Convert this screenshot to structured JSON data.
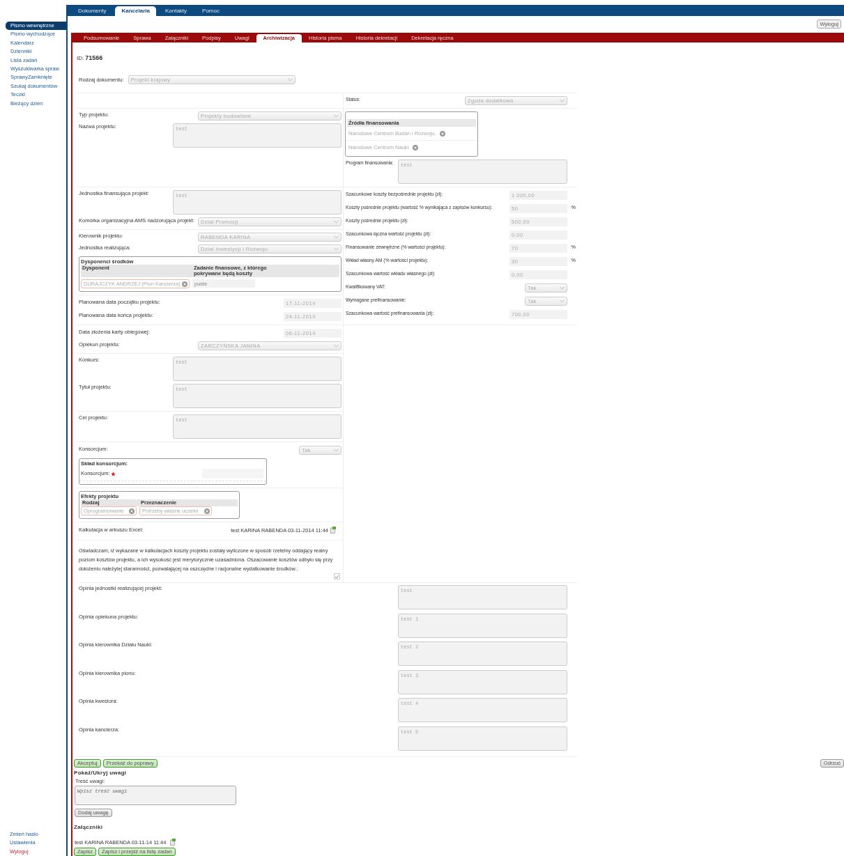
{
  "top_nav": [
    {
      "label": "Dokumenty",
      "selected": false
    },
    {
      "label": "Kancelaria",
      "selected": true
    },
    {
      "label": "Kontakty",
      "selected": false
    },
    {
      "label": "Pomoc",
      "selected": false
    }
  ],
  "logout_button": "Wyloguj",
  "sidebar": {
    "items": [
      {
        "label": "Pismo wewnętrzne",
        "selected": true
      },
      {
        "label": "Pismo wychodzące",
        "selected": false
      },
      {
        "label": "Kalendarz",
        "selected": false
      },
      {
        "label": "Dzienniki",
        "selected": false
      },
      {
        "label": "Lista zadań",
        "selected": false
      },
      {
        "label": "Wyszukiwarka spraw",
        "selected": false
      },
      {
        "label": "SprawyZamknięte",
        "selected": false
      },
      {
        "label": "Szukaj dokumentów",
        "selected": false
      },
      {
        "label": "Teczki",
        "selected": false
      },
      {
        "label": "Bieżący dzień",
        "selected": false
      }
    ],
    "bottom_links": [
      {
        "label": "Zmień hasło",
        "kind": "link"
      },
      {
        "label": "Ustawienia",
        "kind": "link"
      },
      {
        "label": "Wyloguj",
        "kind": "logout"
      }
    ]
  },
  "tabs": [
    {
      "label": "Podsumowanie",
      "selected": false
    },
    {
      "label": "Sprawa",
      "selected": false
    },
    {
      "label": "Załączniki",
      "selected": false
    },
    {
      "label": "Podpisy",
      "selected": false
    },
    {
      "label": "Uwagi",
      "selected": false
    },
    {
      "label": "Archiwizacja",
      "selected": true
    },
    {
      "label": "Historia pisma",
      "selected": false
    },
    {
      "label": "Historia dekretacji",
      "selected": false
    },
    {
      "label": "Dekretacja ręczna",
      "selected": false
    }
  ],
  "id_label": "ID:",
  "id_value": "71566",
  "document_type": {
    "label": "Rodzaj dokumentu:",
    "value": "Projekt krajowy"
  },
  "bands": [
    {
      "right": [
        [
          {
            "kind": "select",
            "label": "Status:",
            "value": "Zgoda dodatkowa"
          }
        ]
      ]
    },
    {
      "left": [
        [
          {
            "kind": "select",
            "label": "Typ projektu:",
            "value": "Projekty budowlane"
          },
          {
            "kind": "textarea",
            "label": "Nazwa projektu:",
            "value": "test"
          }
        ]
      ],
      "right": [
        [
          {
            "kind": "sources",
            "title": "Źródła finansowania",
            "items": [
              "Narodowe Centrum Badan i Rozwoju,",
              "Narodowe Centrum Nauki"
            ]
          },
          {
            "kind": "textarea",
            "label": "Program finansowania:",
            "value": "test"
          }
        ]
      ]
    },
    {
      "left": [
        [
          {
            "kind": "textarea",
            "label": "Jednostka finansująca projekt:",
            "value": "test"
          },
          {
            "kind": "select",
            "label": "Komórka organizacyjna AMS nadzorująca projekt:",
            "value": "Dział Promocji"
          }
        ],
        [
          {
            "kind": "select",
            "label": "Kierownik projektu:",
            "value": "RABENDA KARINA"
          },
          {
            "kind": "select",
            "label": "Jednostka realizująca:",
            "value": "Dział Inwestycji i Rozwoju"
          },
          {
            "kind": "disposers",
            "title": "Dysponenci środków",
            "columns": [
              "Dysponent",
              "Zadanie finansowe, z którego pokrywane będą koszty"
            ],
            "rows": [
              {
                "disposer": "DURAJCZYK ANDRZEJ (Pion Kanclerza)",
                "placeholder": "puste"
              }
            ]
          }
        ],
        [
          {
            "kind": "date",
            "label": "Planowana data początku projektu:",
            "value": "17-11-2014"
          },
          {
            "kind": "date",
            "label": "Planowana data końca projektu:",
            "value": "24-11-2014"
          }
        ]
      ],
      "right": [
        [
          {
            "kind": "number",
            "label": "Szacunkowe koszty bezpośrednie projektu (zł):",
            "value": "1 000,00"
          },
          {
            "kind": "number",
            "label": "Koszty pośrednie projektu (wartość % wynikająca z zapisów konkursu):",
            "value": "50",
            "unit": "%"
          },
          {
            "kind": "number",
            "label": "Koszty pośrednie projektu (zł):",
            "value": "500,00"
          },
          {
            "kind": "number",
            "label": "Szacunkowa łączna wartość projektu (zł):",
            "value": "0,00"
          },
          {
            "kind": "number",
            "label": "Finansowanie zewnętrzne (% wartości projektu):",
            "value": "70",
            "unit": "%"
          },
          {
            "kind": "number",
            "label": "Wkład własny AM (% wartości projektu):",
            "value": "30",
            "unit": "%"
          },
          {
            "kind": "number",
            "label": "Szacunkowa wartość wkładu własnego (zł):",
            "value": "0,00"
          },
          {
            "kind": "choice",
            "label": "Kwalifikowany VAT:",
            "value": "Tak"
          },
          {
            "kind": "choice",
            "label": "Wymagane prefinansowanie:",
            "value": "Tak"
          },
          {
            "kind": "number",
            "label": "Szacunkowa wartość prefinansowania (zł):",
            "value": "700,00"
          }
        ]
      ]
    },
    {
      "left": [
        [
          {
            "kind": "date",
            "label": "Data złożenia karty obiegowej:",
            "value": "06-11-2014"
          },
          {
            "kind": "select",
            "label": "Opiekun projektu:",
            "value": "ZARCZYŃSKA JANINA"
          }
        ],
        [
          {
            "kind": "textarea",
            "label": "Konkurs:",
            "value": "test"
          },
          {
            "kind": "textarea",
            "label": "Tytuł projektu:",
            "value": "test"
          }
        ],
        [
          {
            "kind": "textarea",
            "label": "Cel projektu:",
            "value": "test"
          }
        ],
        [
          {
            "kind": "choice",
            "label": "Konsorcjum:",
            "value": "Tak"
          },
          {
            "kind": "consortium",
            "title": "Skład konsorcjum:",
            "field_label": "Konsorcjum:",
            "required": true
          }
        ],
        [
          {
            "kind": "effects",
            "title": "Efekty projektu",
            "columns": [
              "Rodzaj",
              "Przeznaczenie"
            ],
            "rows": [
              {
                "type": "Oprogramowanie",
                "purpose": "Potrzeby własne uczelni"
              }
            ]
          }
        ],
        [
          {
            "kind": "attachment",
            "label": "Kalkulacja w arkuszu Excel:",
            "file": "test KARINA RABENDA 03-11-2014 11:44"
          }
        ],
        [
          {
            "kind": "statement",
            "text": "Oświadczam, iż wykazane w kalkulacjach koszty projektu zostały wyliczone w sposób rzetelny oddający realny poziom kosztów projektu, a ich wysokość jest merytorycznie uzasadniona. Oszacowanie kosztów odbyło się przy dołożeniu należytej staranności, pozwalającej na oszczędne i racjonalne wydatkowanie środków.:",
            "checked": true
          }
        ]
      ]
    }
  ],
  "opinions": [
    {
      "label": "Opinia jednostki realizującej projekt:",
      "value": "test"
    },
    {
      "label": "Opinia opiekuna projektu:",
      "value": "test 1"
    },
    {
      "label": "Opinia kierownika Działu Nauki:",
      "value": "test 2"
    },
    {
      "label": "Opinia kierownika pionu:",
      "value": "test 3"
    },
    {
      "label": "Opinia kwestora:",
      "value": "test 4"
    },
    {
      "label": "Opinia kanclerza:",
      "value": "test 5"
    }
  ],
  "actions": [
    "Akceptuj",
    "Przekaż do poprawy"
  ],
  "reject_button": "Odrzuć",
  "notes": {
    "toggle": "Pokaż/Ukryj uwagi",
    "label": "Treść uwagi:",
    "placeholder": "Wpisz treść uwagi",
    "button": "Dodaj uwagę"
  },
  "attachments": {
    "title": "Załączniki",
    "items": [
      "test KARINA RABENDA 03-11-14 11:44"
    ]
  },
  "footer_buttons": [
    "Zapisz",
    "Zapisz i przejdź na listę zadań"
  ]
}
